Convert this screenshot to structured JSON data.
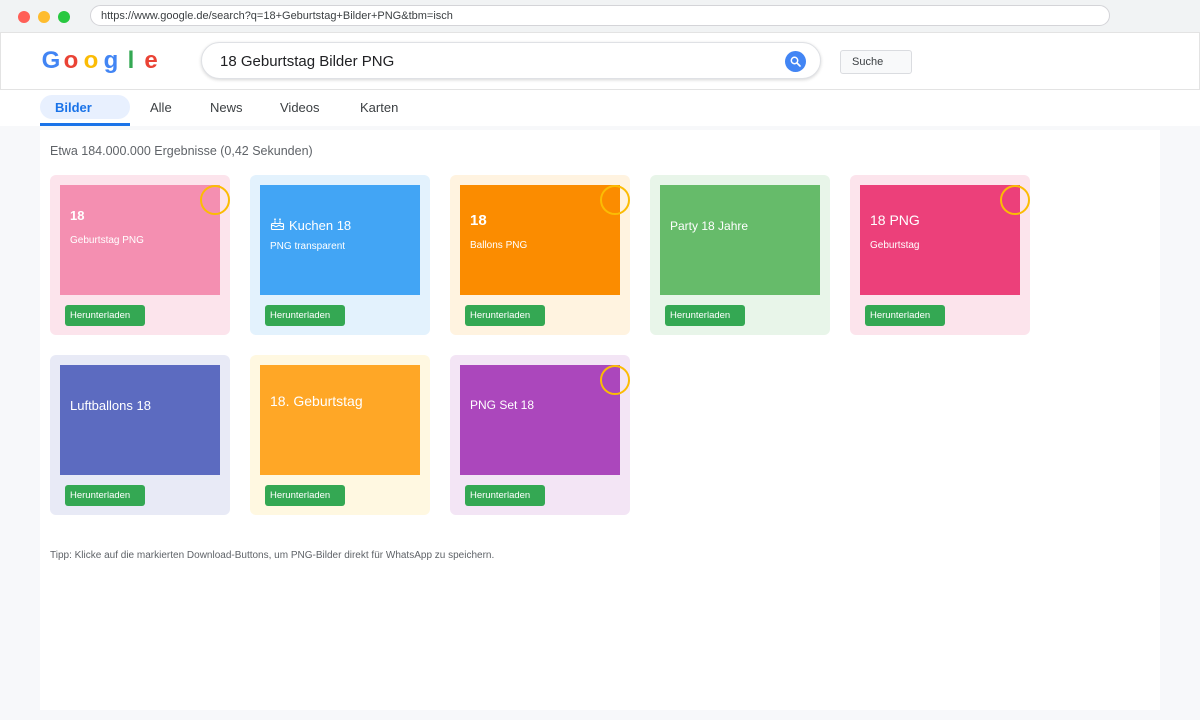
{
  "browser": {
    "url": "https://www.google.de/search?q=18+Geburtstag+Bilder+PNG&tbm=isch"
  },
  "header": {
    "logo_letters": [
      "G",
      "o",
      "o",
      "g",
      "l",
      "e"
    ],
    "logo_colors": [
      "#4285f4",
      "#ea4335",
      "#fbbc05",
      "#4285f4",
      "#34a853",
      "#ea4335"
    ],
    "search_value": "18 Geburtstag Bilder PNG",
    "search_button_label": "Suche"
  },
  "tabs": {
    "active": "Bilder",
    "items": [
      "Alle",
      "News",
      "Videos",
      "Karten"
    ]
  },
  "results": {
    "stats": "Etwa 184.000.000 Ergebnisse (0,42 Sekunden)",
    "cards": [
      {
        "title": "18",
        "subtitle": "Geburtstag PNG",
        "button": "Herunterladen",
        "color": "#f48fb1",
        "bg": "#fce4ec",
        "marked": true
      },
      {
        "icon": "cake-icon",
        "title": "Kuchen 18",
        "subtitle": "PNG transparent",
        "button": "Herunterladen",
        "color": "#42a5f5",
        "bg": "#e3f2fd",
        "marked": false
      },
      {
        "title": "18",
        "subtitle": "Ballons PNG",
        "button": "Herunterladen",
        "color": "#fb8c00",
        "bg": "#fff3e0",
        "marked": true
      },
      {
        "title": "Party 18 Jahre",
        "button": "Herunterladen",
        "color": "#66bb6a",
        "bg": "#e8f5e9",
        "marked": false
      },
      {
        "title": "18 PNG",
        "subtitle": "Geburtstag",
        "button": "Herunterladen",
        "color": "#ec407a",
        "bg": "#fce4ec",
        "marked": true
      },
      {
        "title": "Luftballons 18",
        "button": "Herunterladen",
        "color": "#5c6bc0",
        "bg": "#e8eaf6",
        "marked": false
      },
      {
        "title": "18. Geburtstag",
        "button": "Herunterladen",
        "color": "#ffa726",
        "bg": "#fff8e1",
        "marked": false
      },
      {
        "title": "PNG Set 18",
        "button": "Herunterladen",
        "color": "#ab47bc",
        "bg": "#f3e5f5",
        "marked": true
      }
    ]
  },
  "tip": "Tipp: Klicke auf die markierten Download-Buttons, um PNG-Bilder direkt für WhatsApp zu speichern."
}
